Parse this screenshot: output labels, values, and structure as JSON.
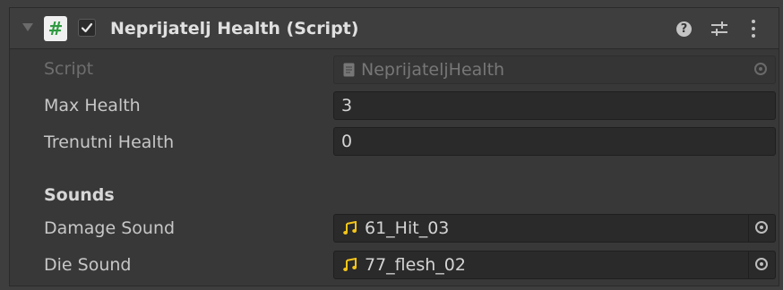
{
  "component": {
    "title": "Neprijatelj Health (Script)",
    "script_icon_glyph": "#",
    "enabled": true
  },
  "fields": {
    "script": {
      "label": "Script",
      "value": "NeprijateljHealth"
    },
    "max_health": {
      "label": "Max Health",
      "value": "3"
    },
    "current_health": {
      "label": "Trenutni Health",
      "value": "0"
    }
  },
  "sounds": {
    "header": "Sounds",
    "damage": {
      "label": "Damage Sound",
      "value": "61_Hit_03"
    },
    "die": {
      "label": "Die Sound",
      "value": "77_flesh_02"
    }
  },
  "icons": {
    "help": "?",
    "audio_clip_color": "#f5c518",
    "script_icon_color": "#2e9a3f"
  }
}
